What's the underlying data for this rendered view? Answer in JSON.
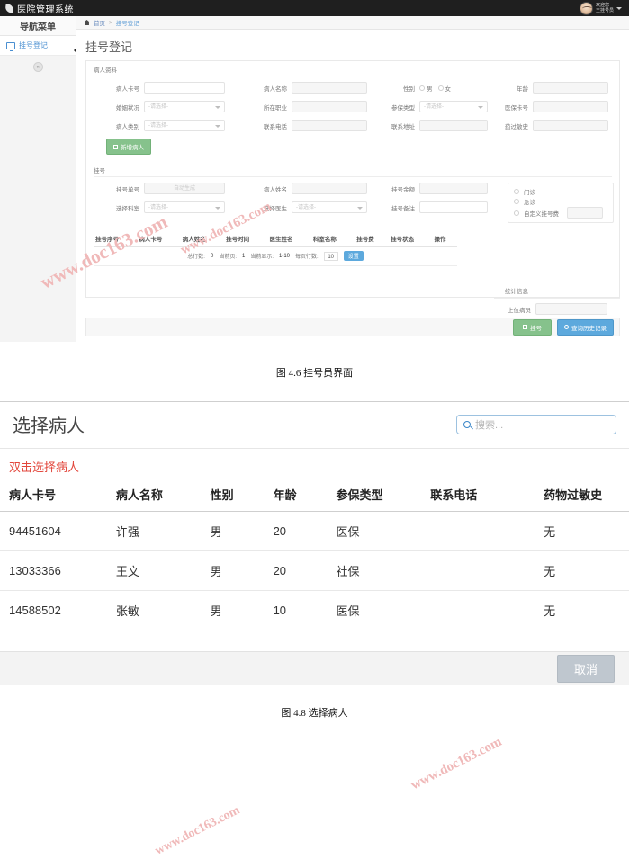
{
  "fig46": {
    "topbar": {
      "brand": "医院管理系统",
      "brand_icon": "leaf-icon",
      "welcome_line1": "欢迎您",
      "welcome_line2": "王挂号员"
    },
    "sidebar": {
      "title": "导航菜单",
      "items": [
        {
          "label": "挂号登记",
          "icon": "monitor-icon"
        }
      ],
      "collapse_label": "«"
    },
    "breadcrumb": {
      "home": "首页",
      "separator": ">",
      "current": "挂号登记"
    },
    "page_title": "挂号登记",
    "patient_section": {
      "title": "病人资料",
      "fields": [
        {
          "label": "病人卡号",
          "value": ""
        },
        {
          "label": "病人名称",
          "value": ""
        },
        {
          "label": "性别",
          "options": [
            "男",
            "女"
          ]
        },
        {
          "label": "年龄",
          "value": ""
        },
        {
          "label": "婚姻状况",
          "value": "-请选择-"
        },
        {
          "label": "所在职业",
          "value": ""
        },
        {
          "label": "参保类型",
          "value": "-请选择-"
        },
        {
          "label": "医保卡号",
          "value": ""
        },
        {
          "label": "病人类别",
          "value": "-请选择-"
        },
        {
          "label": "联系电话",
          "value": ""
        },
        {
          "label": "联系地址",
          "value": ""
        },
        {
          "label": "药过敏史",
          "value": ""
        }
      ],
      "add_button": "新增病人"
    },
    "register_section": {
      "title": "挂号",
      "fields": [
        {
          "label": "挂号单号",
          "value": "自动生成"
        },
        {
          "label": "病人姓名",
          "value": ""
        },
        {
          "label": "挂号金额",
          "value": ""
        },
        {
          "label": "选择科室",
          "value": "-请选择-"
        },
        {
          "label": "选择医生",
          "value": "-请选择-"
        },
        {
          "label": "挂号备注",
          "value": ""
        }
      ],
      "fee_options": [
        "门诊",
        "急诊",
        "自定义挂号费"
      ],
      "custom_fee_value": ""
    },
    "table": {
      "headers": [
        "挂号序号",
        "病人卡号",
        "病人姓名",
        "挂号时间",
        "医生姓名",
        "科室名称",
        "挂号费",
        "挂号状态",
        "操作"
      ],
      "rows": []
    },
    "pager": {
      "total_label": "总行数:",
      "total_value": "0",
      "page_label": "当前页:",
      "page_value": "1",
      "showing_label": "当前显示:",
      "showing_value": "1-10",
      "perpage_label": "每页行数:",
      "perpage_value": "10",
      "set_button": "设置"
    },
    "stats": {
      "title": "统计信息",
      "label": "上位病员",
      "value": ""
    },
    "actions": {
      "primary": "挂号",
      "secondary": "查询历史记录"
    },
    "caption": "图 4.6  挂号员界面"
  },
  "watermarks": [
    "www.doc163.com",
    "www.doc163.com",
    "www.doc163.com",
    "www.doc163.com"
  ],
  "fig48": {
    "title": "选择病人",
    "search_placeholder": "搜索...",
    "search_value": "",
    "hint": "双击选择病人",
    "headers": [
      "病人卡号",
      "病人名称",
      "性别",
      "年龄",
      "参保类型",
      "联系电话",
      "药物过敏史"
    ],
    "rows": [
      {
        "card": "94451604",
        "name": "许强",
        "sex": "男",
        "age": "20",
        "insurance": "医保",
        "phone": "",
        "allergy": "无"
      },
      {
        "card": "13033366",
        "name": "王文",
        "sex": "男",
        "age": "20",
        "insurance": "社保",
        "phone": "",
        "allergy": "无"
      },
      {
        "card": "14588502",
        "name": "张敏",
        "sex": "男",
        "age": "10",
        "insurance": "医保",
        "phone": "",
        "allergy": "无"
      }
    ],
    "cancel_button": "取消",
    "caption": "图 4.8  选择病人"
  },
  "colors": {
    "topbar": "#1f1f1f",
    "accent_blue": "#5da9dd",
    "accent_green": "#86c28c",
    "hint_red": "#e2463b",
    "watermark": "#f0b9b9"
  }
}
